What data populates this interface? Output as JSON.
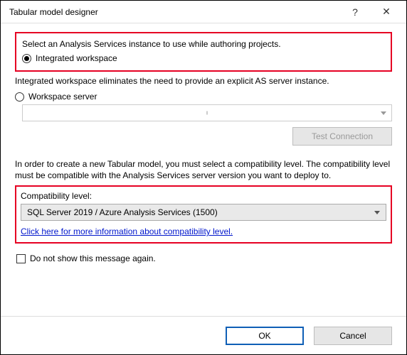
{
  "titlebar": {
    "title": "Tabular model designer",
    "help": "?",
    "close": "✕"
  },
  "section1": {
    "instruction": "Select an Analysis Services instance to use while authoring projects.",
    "option_integrated": "Integrated workspace"
  },
  "note_integrated": "Integrated workspace eliminates the need to provide an explicit AS server instance.",
  "workspace": {
    "option_server": "Workspace server",
    "test_connection": "Test Connection"
  },
  "compat": {
    "intro": "In order to create a new Tabular model, you must select a compatibility level. The compatibility level must be compatible with the Analysis Services server version you want to deploy to.",
    "label": "Compatibility level:",
    "value": "SQL Server 2019 / Azure Analysis Services (1500)",
    "link": "Click here for more information about compatibility level."
  },
  "checkbox": {
    "label": "Do not show this message again."
  },
  "footer": {
    "ok": "OK",
    "cancel": "Cancel"
  }
}
